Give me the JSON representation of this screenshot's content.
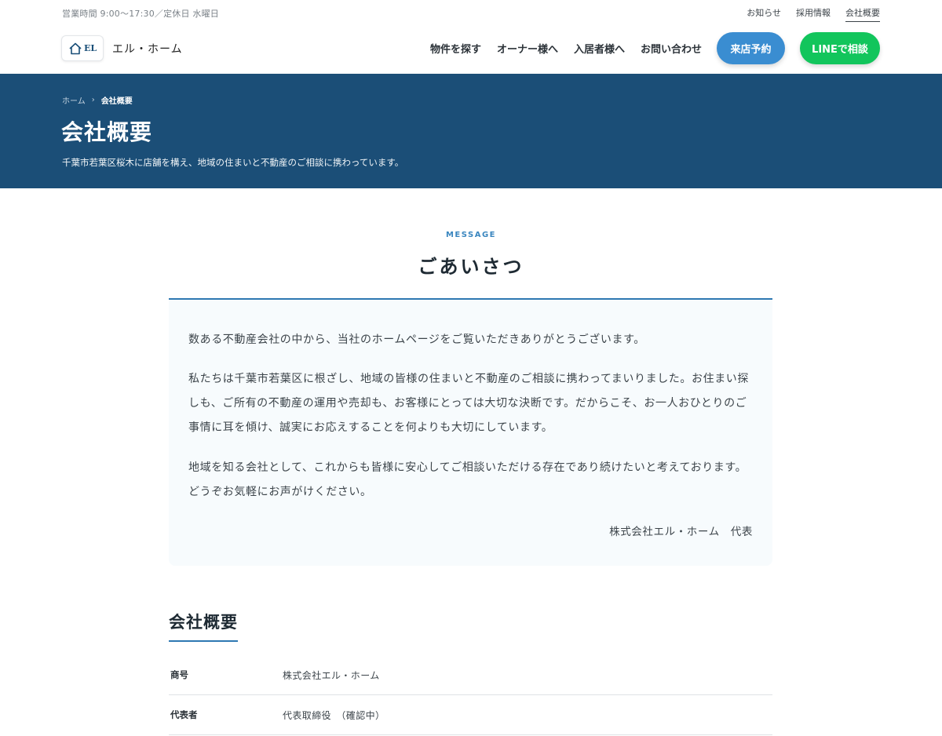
{
  "topbar": {
    "hours": "営業時間 9:00〜17:30／定休日 水曜日",
    "links": [
      {
        "label": "お知らせ"
      },
      {
        "label": "採用情報"
      },
      {
        "label": "会社概要"
      }
    ]
  },
  "header": {
    "logo_mark": "EL",
    "logo_name": "エル・ホーム",
    "nav": [
      {
        "label": "物件を探す"
      },
      {
        "label": "オーナー様へ"
      },
      {
        "label": "入居者様へ"
      },
      {
        "label": "お問い合わせ"
      }
    ],
    "visit_button": "来店予約",
    "line_button": "LINEで相談"
  },
  "hero": {
    "breadcrumb_home": "ホーム",
    "breadcrumb_sep": "›",
    "breadcrumb_current": "会社概要",
    "title": "会社概要",
    "subtitle": "千葉市若葉区桜木に店舗を構え、地域の住まいと不動産のご相談に携わっています。"
  },
  "message": {
    "eyebrow": "MESSAGE",
    "title": "ごあいさつ",
    "paragraphs": [
      "数ある不動産会社の中から、当社のホームページをご覧いただきありがとうございます。",
      "私たちは千葉市若葉区に根ざし、地域の皆様の住まいと不動産のご相談に携わってまいりました。お住まい探しも、ご所有の不動産の運用や売却も、お客様にとっては大切な決断です。だからこそ、お一人おひとりのご事情に耳を傾け、誠実にお応えすることを何よりも大切にしています。",
      "地域を知る会社として、これからも皆様に安心してご相談いただける存在であり続けたいと考えております。どうぞお気軽にお声がけください。"
    ],
    "signature": "株式会社エル・ホーム　代表"
  },
  "overview": {
    "title": "会社概要",
    "rows": [
      {
        "label": "商号",
        "value": "株式会社エル・ホーム"
      },
      {
        "label": "代表者",
        "value": "代表取締役　（確認中）"
      }
    ]
  },
  "colors": {
    "brand_navy": "#1b4e77",
    "accent_blue": "#3a8dd1",
    "line_green": "#12c55c"
  }
}
